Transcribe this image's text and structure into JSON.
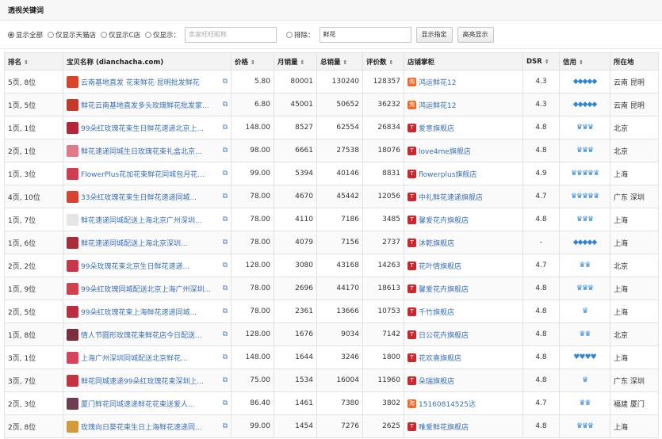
{
  "page": {
    "title": "透视关键词"
  },
  "filter": {
    "options": [
      {
        "label": "显示全部",
        "checked": true
      },
      {
        "label": "仅显示天猫店",
        "checked": false
      },
      {
        "label": "仅显示C店",
        "checked": false
      },
      {
        "label": "仅显示：",
        "checked": false
      }
    ],
    "shop_input_placeholder": "卖家旺旺昵称",
    "exclude_label": "排除：",
    "exclude_value": "鲜花",
    "highlight_button": "显示指定",
    "cancel_highlight_button": "高亮显示"
  },
  "table": {
    "headers": [
      "排名",
      "宝贝名称 (dianchacha.com)",
      "价格",
      "月销量",
      "总销量",
      "评价数",
      "店铺掌柜",
      "DSR",
      "信用",
      "所在地"
    ],
    "rows": [
      {
        "rank": "5页, 8位",
        "title": "云南基地直发 花束鲜花·昆明批发鲜花",
        "price": "5.80",
        "monthly": "80001",
        "total": "130240",
        "reviews": "128357",
        "shop": "鸿运鲜花12",
        "shop_type": "c",
        "dsr": "4.3",
        "credit": "◆◆◆◆◆",
        "location": "云南 昆明",
        "thumb": "#d9452b"
      },
      {
        "rank": "1页, 5位",
        "title": "鲜花云南基地直发多头玫瑰鲜花批发家...",
        "price": "6.80",
        "monthly": "45001",
        "total": "50652",
        "reviews": "36232",
        "shop": "鸿运鲜花12",
        "shop_type": "c",
        "dsr": "4.3",
        "credit": "◆◆◆◆◆",
        "location": "云南 昆明",
        "thumb": "#c23a2a"
      },
      {
        "rank": "1页, 1位",
        "title": "99朵红玫瑰花束生日鲜花速递北京上...",
        "price": "148.00",
        "monthly": "8527",
        "total": "62554",
        "reviews": "26834",
        "shop": "爱意旗舰店",
        "shop_type": "t",
        "dsr": "4.8",
        "credit": "♛♛♛",
        "location": "北京",
        "thumb": "#b3263a"
      },
      {
        "rank": "2页, 1位",
        "title": "鲜花速递同城生日玫瑰花束礼盒北京...",
        "price": "98.00",
        "monthly": "6661",
        "total": "27538",
        "reviews": "18076",
        "shop": "love4me旗舰店",
        "shop_type": "t",
        "dsr": "4.8",
        "credit": "♛♛♛",
        "location": "北京",
        "thumb": "#e07a8a"
      },
      {
        "rank": "1页, 3位",
        "title": "FlowerPlus花加花束鲜花同城包月花...",
        "price": "99.00",
        "monthly": "5394",
        "total": "40146",
        "reviews": "8831",
        "shop": "flowerplus旗舰店",
        "shop_type": "t",
        "dsr": "4.9",
        "credit": "♛♛♛♛♛",
        "location": "上海",
        "thumb": "#cf3d52"
      },
      {
        "rank": "4页, 10位",
        "title": "33朵红玫瑰花束生日鲜花速递同城...",
        "price": "78.00",
        "monthly": "4670",
        "total": "45442",
        "reviews": "12056",
        "shop": "中礼鲜花速递旗舰店",
        "shop_type": "t",
        "dsr": "4.7",
        "credit": "♛♛♛♛♛",
        "location": "广东 深圳",
        "thumb": "#d7432f"
      },
      {
        "rank": "1页, 7位",
        "title": "鲜花速递同城配送上海北京广州深圳...",
        "price": "78.00",
        "monthly": "4110",
        "total": "7186",
        "reviews": "3485",
        "shop": "馨爱花卉旗舰店",
        "shop_type": "t",
        "dsr": "4.8",
        "credit": "♛♛♛",
        "location": "上海",
        "thumb": "#e5e5e5"
      },
      {
        "rank": "1页, 6位",
        "title": "鲜花速递同城配送上海北京深圳...",
        "price": "78.00",
        "monthly": "4079",
        "total": "7156",
        "reviews": "2737",
        "shop": "沐乾旗舰店",
        "shop_type": "t",
        "dsr": "-",
        "credit": "◆◆◆◆◆",
        "location": "上海",
        "thumb": "#a82c3a"
      },
      {
        "rank": "2页, 2位",
        "title": "99朵玫瑰花束北京生日鲜花速递...",
        "price": "128.00",
        "monthly": "3080",
        "total": "43168",
        "reviews": "14263",
        "shop": "花叶情旗舰店",
        "shop_type": "t",
        "dsr": "4.7",
        "credit": "♛♛",
        "location": "北京",
        "thumb": "#c9364a"
      },
      {
        "rank": "1页, 9位",
        "title": "99朵红玫瑰同城配送北京上海广州深圳...",
        "price": "78.00",
        "monthly": "2696",
        "total": "44170",
        "reviews": "18613",
        "shop": "馨爱花卉旗舰店",
        "shop_type": "t",
        "dsr": "4.8",
        "credit": "♛♛♛",
        "location": "上海",
        "thumb": "#d0404d"
      },
      {
        "rank": "2页, 5位",
        "title": "99朵红玫瑰花束上海鲜花速递同城...",
        "price": "78.00",
        "monthly": "2361",
        "total": "13666",
        "reviews": "10753",
        "shop": "千竹旗舰店",
        "shop_type": "t",
        "dsr": "4.8",
        "credit": "♛",
        "location": "上海",
        "thumb": "#b8303f"
      },
      {
        "rank": "1页, 8位",
        "title": "情人节圆形玫瑰花束鲜花店今日配送...",
        "price": "128.00",
        "monthly": "1676",
        "total": "9034",
        "reviews": "7142",
        "shop": "日公花卉旗舰店",
        "shop_type": "t",
        "dsr": "4.8",
        "credit": "♛♛",
        "location": "北京",
        "thumb": "#7b2e3f"
      },
      {
        "rank": "3页, 1位",
        "title": "上海广州深圳同城配送北京鲜花...",
        "price": "148.00",
        "monthly": "1644",
        "total": "3246",
        "reviews": "1800",
        "shop": "花欢喜旗舰店",
        "shop_type": "t",
        "dsr": "4.8",
        "credit": "♥♥♥♥",
        "location": "上海",
        "thumb": "#d8425a"
      },
      {
        "rank": "3页, 7位",
        "title": "鲜花同城速递99朵红玫瑰花束深圳上...",
        "price": "75.00",
        "monthly": "1534",
        "total": "16004",
        "reviews": "11960",
        "shop": "朵瑞旗舰店",
        "shop_type": "t",
        "dsr": "4.8",
        "credit": "♛",
        "location": "广东 深圳",
        "thumb": "#c7323f"
      },
      {
        "rank": "2页, 3位",
        "title": "厦门鲜花同城速递鲜花花束送爱人...",
        "price": "86.40",
        "monthly": "1461",
        "total": "7380",
        "reviews": "3802",
        "shop": "15160814525达",
        "shop_type": "c",
        "dsr": "4.7",
        "credit": "♛♛",
        "location": "福建 厦门",
        "thumb": "#6f3d52"
      },
      {
        "rank": "2页, 8位",
        "title": "玫瑰向日葵花束生日上海鲜花速递同...",
        "price": "99.00",
        "monthly": "1454",
        "total": "7276",
        "reviews": "2625",
        "shop": "唯爱鲜花旗舰店",
        "shop_type": "t",
        "dsr": "4.8",
        "credit": "♛♛♛",
        "location": "上海",
        "thumb": "#d29a3a"
      }
    ]
  },
  "colors": {
    "tmall": "#c8282e",
    "taobao": "#f26b2a",
    "link": "#3a6fb7",
    "credit": "#2f86d6"
  }
}
